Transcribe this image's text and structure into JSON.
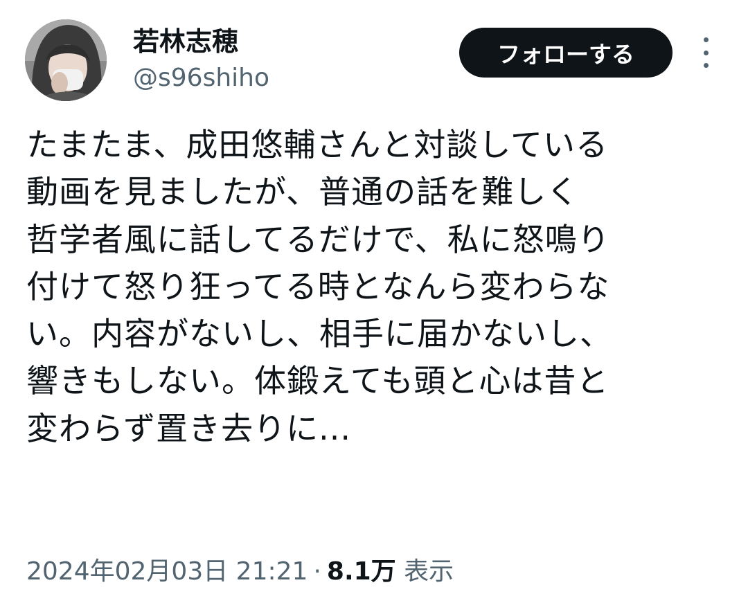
{
  "author": {
    "display_name": "若林志穂",
    "handle": "@s96shiho",
    "avatar_icon": "user-avatar-photo"
  },
  "actions": {
    "follow_label": "フォローする",
    "more_icon": "more-vertical-icon"
  },
  "tweet": {
    "lines": [
      "たまたま、成田悠輔さんと対談している",
      "動画を見ましたが、普通の話を難しく",
      "哲学者風に話してるだけで、私に怒鳴り",
      "付けて怒り狂ってる時となんら変わらな",
      "い。内容がないし、相手に届かないし、",
      "響きもしない。体鍛えても頭と心は昔と",
      "変わらず置き去りに..."
    ]
  },
  "meta": {
    "timestamp": "2024年02月03日 21:21",
    "separator": "·",
    "views_count": "8.1万",
    "views_label": "表示"
  },
  "colors": {
    "text_primary": "#0f1419",
    "text_secondary": "#536471",
    "button_bg": "#0f1419",
    "button_text": "#ffffff"
  }
}
